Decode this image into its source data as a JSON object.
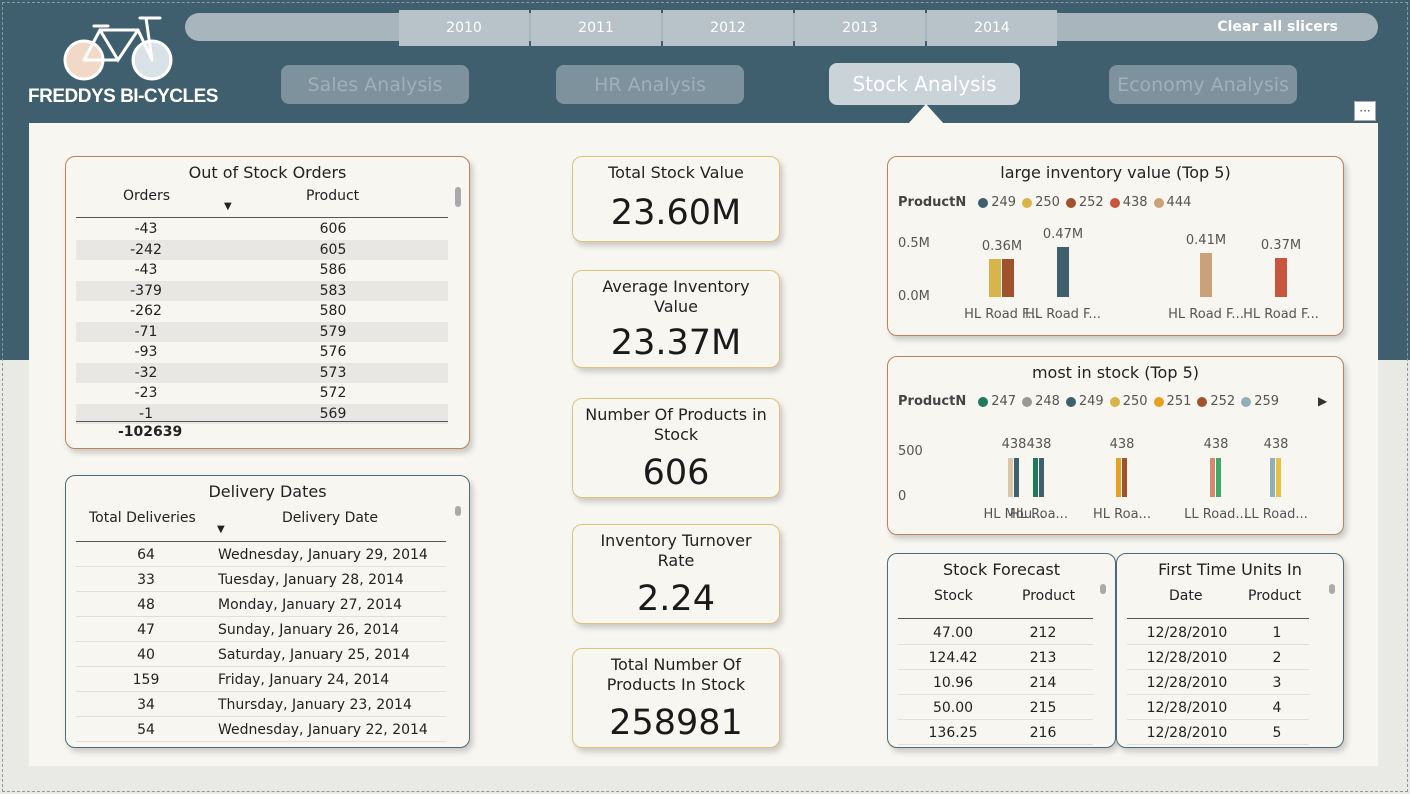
{
  "brand": {
    "name": "FREDDYS BI-CYCLES"
  },
  "slicer": {
    "years": [
      "2010",
      "2011",
      "2012",
      "2013",
      "2014"
    ],
    "clear_label": "Clear all slicers"
  },
  "nav": {
    "buttons": [
      "Sales Analysis",
      "HR Analysis",
      "Stock Analysis",
      "Economy Analysis"
    ],
    "active": "Stock Analysis"
  },
  "more_label": "···",
  "out_of_stock": {
    "title": "Out of Stock Orders",
    "headers": [
      "Orders",
      "Product"
    ],
    "rows": [
      [
        "-43",
        "606"
      ],
      [
        "-242",
        "605"
      ],
      [
        "-43",
        "586"
      ],
      [
        "-379",
        "583"
      ],
      [
        "-262",
        "580"
      ],
      [
        "-71",
        "579"
      ],
      [
        "-93",
        "576"
      ],
      [
        "-32",
        "573"
      ],
      [
        "-23",
        "572"
      ],
      [
        "-1",
        "569"
      ]
    ],
    "total": "-102639"
  },
  "delivery": {
    "title": "Delivery Dates",
    "headers": [
      "Total Deliveries",
      "Delivery Date"
    ],
    "rows": [
      [
        "64",
        "Wednesday, January 29, 2014"
      ],
      [
        "33",
        "Tuesday, January 28, 2014"
      ],
      [
        "48",
        "Monday, January 27, 2014"
      ],
      [
        "47",
        "Sunday, January 26, 2014"
      ],
      [
        "40",
        "Saturday, January 25, 2014"
      ],
      [
        "159",
        "Friday, January 24, 2014"
      ],
      [
        "34",
        "Thursday, January 23, 2014"
      ],
      [
        "54",
        "Wednesday, January 22, 2014"
      ]
    ]
  },
  "kpis": [
    {
      "title": "Total Stock Value",
      "value": "23.60M"
    },
    {
      "title": "Average Inventory Value",
      "value": "23.37M"
    },
    {
      "title": "Number Of Products in Stock",
      "value": "606"
    },
    {
      "title": "Inventory Turnover Rate",
      "value": "2.24"
    },
    {
      "title": "Total Number Of Products In Stock",
      "value": "258981"
    }
  ],
  "chart_data": [
    {
      "type": "bar",
      "title": "large inventory value (Top 5)",
      "legend_title": "ProductN",
      "legend": [
        {
          "name": "249",
          "color": "#3f5f6e"
        },
        {
          "name": "250",
          "color": "#d9b44a"
        },
        {
          "name": "252",
          "color": "#a0522d"
        },
        {
          "name": "438",
          "color": "#c8553d"
        },
        {
          "name": "444",
          "color": "#c9a27a"
        }
      ],
      "categories": [
        "HL Road F...",
        "HL Road F...",
        "HL Road F...",
        "HL Road F..."
      ],
      "data_labels": [
        "0.36M",
        "0.47M",
        "0.41M",
        "0.37M"
      ],
      "yticks": [
        "0.5M",
        "0.0M"
      ],
      "ylim": [
        0,
        0.6
      ],
      "groups": [
        [
          {
            "series": "250",
            "value": 0.36,
            "color": "#d9b44a"
          },
          {
            "series": "252",
            "value": 0.36,
            "color": "#a0522d"
          }
        ],
        [
          {
            "series": "249",
            "value": 0.47,
            "color": "#3f5f6e"
          }
        ],
        [
          {
            "series": "444",
            "value": 0.41,
            "color": "#c9a27a"
          }
        ],
        [
          {
            "series": "438",
            "value": 0.37,
            "color": "#c8553d"
          }
        ]
      ]
    },
    {
      "type": "bar",
      "title": "most in stock (Top 5)",
      "legend_title": "ProductN",
      "legend": [
        {
          "name": "247",
          "color": "#1e7a5a"
        },
        {
          "name": "248",
          "color": "#9a9a94"
        },
        {
          "name": "249",
          "color": "#3f5f6e"
        },
        {
          "name": "250",
          "color": "#d9b44a"
        },
        {
          "name": "251",
          "color": "#e8a020"
        },
        {
          "name": "252",
          "color": "#a0522d"
        },
        {
          "name": "259",
          "color": "#8fb0b8"
        }
      ],
      "categories": [
        "HL Mou...",
        "HL Roa...",
        "HL Roa...",
        "LL Road...",
        "LL Road..."
      ],
      "data_labels": [
        "438",
        "438",
        "438",
        "438",
        "438"
      ],
      "yticks": [
        "500",
        "0"
      ],
      "ylim": [
        0,
        600
      ],
      "groups": [
        [
          {
            "value": 438,
            "color": "#d8c7a8"
          },
          {
            "value": 438,
            "color": "#3f5f6e"
          }
        ],
        [
          {
            "value": 438,
            "color": "#1e7a5a"
          },
          {
            "value": 438,
            "color": "#3f5f6e"
          }
        ],
        [
          {
            "value": 438,
            "color": "#e8a020"
          },
          {
            "value": 438,
            "color": "#a0522d"
          }
        ],
        [
          {
            "value": 438,
            "color": "#d9876a"
          },
          {
            "value": 438,
            "color": "#3fa86a"
          }
        ],
        [
          {
            "value": 438,
            "color": "#8fb0b8"
          },
          {
            "value": 438,
            "color": "#e8c040"
          }
        ]
      ]
    }
  ],
  "forecast": {
    "title": "Stock Forecast",
    "headers": [
      "Stock",
      "Product"
    ],
    "rows": [
      [
        "47.00",
        "212"
      ],
      [
        "124.42",
        "213"
      ],
      [
        "10.96",
        "214"
      ],
      [
        "50.00",
        "215"
      ],
      [
        "136.25",
        "216"
      ]
    ]
  },
  "first_units": {
    "title": "First Time Units In",
    "headers": [
      "Date",
      "Product"
    ],
    "rows": [
      [
        "12/28/2010",
        "1"
      ],
      [
        "12/28/2010",
        "2"
      ],
      [
        "12/28/2010",
        "3"
      ],
      [
        "12/28/2010",
        "4"
      ],
      [
        "12/28/2010",
        "5"
      ]
    ]
  }
}
